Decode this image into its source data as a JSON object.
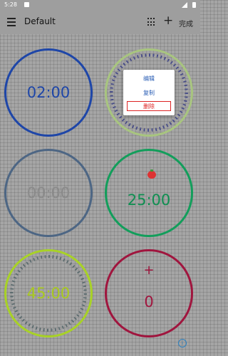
{
  "status_bar": {
    "time": "5:28"
  },
  "toolbar": {
    "title": "Default",
    "done_label": "完成"
  },
  "timers": [
    {
      "time": "02:00",
      "color": "#1e46a8"
    },
    {
      "time": "",
      "color": "#a8c57f"
    },
    {
      "time": "00:00",
      "color": "#4d6684"
    },
    {
      "time": "25:00",
      "color": "#129e5b"
    },
    {
      "time": "45:00",
      "color": "#a8d226"
    },
    {
      "time": "0",
      "color": "#a0153e"
    }
  ],
  "counter": {
    "plus_label": "+"
  },
  "context_menu": {
    "edit": "编辑",
    "copy": "复制",
    "delete": "删除"
  },
  "icons": [
    "menu-icon",
    "grid-icon",
    "add-icon",
    "tomato-icon",
    "info-icon"
  ]
}
